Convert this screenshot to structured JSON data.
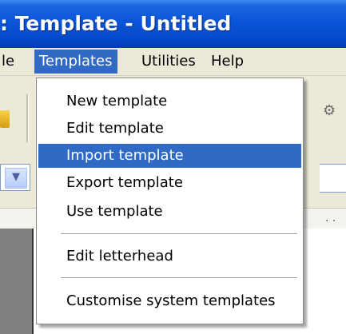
{
  "window": {
    "title": ": Template - Untitled"
  },
  "menubar": {
    "items": [
      {
        "label": "le"
      },
      {
        "label": "Templates"
      },
      {
        "label": "Utilities"
      },
      {
        "label": "Help"
      }
    ]
  },
  "templates_menu": {
    "items": [
      {
        "label": "New template"
      },
      {
        "label": "Edit template"
      },
      {
        "label": "Import template"
      },
      {
        "label": "Export template"
      },
      {
        "label": "Use template"
      },
      {
        "label": "Edit letterhead"
      },
      {
        "label": "Customise system templates"
      }
    ],
    "highlighted_item": "Import template"
  },
  "ruler": {
    "marker": ". ."
  },
  "colors": {
    "titlebar": "#0a55d8",
    "menu_highlight": "#316ac5",
    "menu_background": "#ffffff",
    "chrome": "#ece9d8"
  },
  "icons": {
    "toolbar_left": "folder-icon",
    "toolbar_right": "tool-icon",
    "combo_arrow": "chevron-down-icon"
  }
}
